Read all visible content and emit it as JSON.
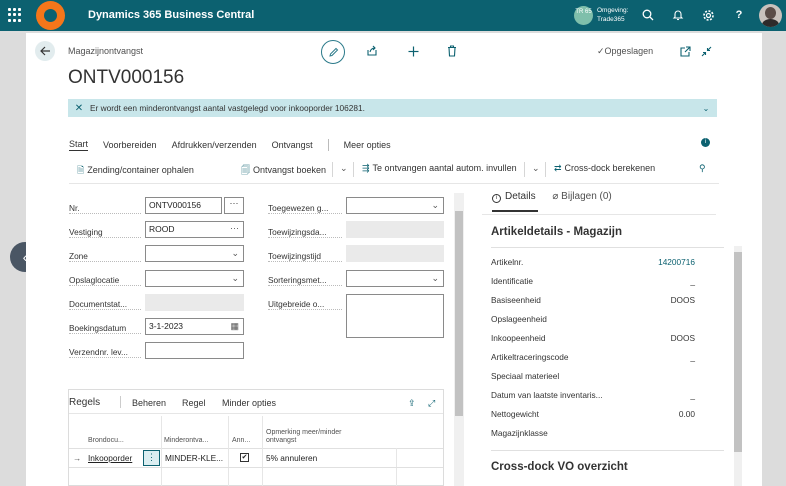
{
  "app": {
    "title": "Dynamics 365 Business Central"
  },
  "environment": {
    "badge": "TR 65",
    "label_line1": "Omgeving:",
    "label_line2": "Trade365"
  },
  "header": {
    "breadcrumb": "Magazijnontvangst",
    "page_title": "ONTV000156",
    "saved_state": "Opgeslagen"
  },
  "notification": {
    "text": "Er wordt een minderontvangst aantal vastgelegd voor inkooporder 106281."
  },
  "tabs": [
    "Start",
    "Voorbereiden",
    "Afdrukken/verzenden",
    "Ontvangst",
    "Meer opties"
  ],
  "actions": {
    "shipment": "Zending/container ophalen",
    "post_receipt": "Ontvangst boeken",
    "autofill": "Te ontvangen aantal autom. invullen",
    "crossdock": "Cross-dock berekenen"
  },
  "form": {
    "nr_label": "Nr.",
    "nr_value": "ONTV000156",
    "vestiging_label": "Vestiging",
    "vestiging_value": "ROOD",
    "zone_label": "Zone",
    "opslaglocatie_label": "Opslaglocatie",
    "documentstat_label": "Documentstat...",
    "boekingsdatum_label": "Boekingsdatum",
    "boekingsdatum_value": "3-1-2023",
    "verzendnr_label": "Verzendnr. lev...",
    "toegewezen_label": "Toegewezen g...",
    "toewijzingsda_label": "Toewijzingsda...",
    "toewijzingstijd_label": "Toewijzingstijd",
    "sorteringsmet_label": "Sorteringsmet...",
    "uitgebreide_label": "Uitgebreide o..."
  },
  "lines": {
    "title": "Regels",
    "menu": [
      "Beheren",
      "Regel",
      "Minder opties"
    ],
    "columns": [
      "Brondocu...",
      "Minderontva...",
      "Ann...",
      "Opmerking meer/minder ontvangst"
    ],
    "rows": [
      {
        "brondocument": "Inkooporder",
        "minderontvangst": "MINDER-KLE...",
        "annuleren": "✔",
        "opmerking": "5% annuleren"
      }
    ]
  },
  "factbox": {
    "tab_details": "Details",
    "tab_attachments": "Bijlagen (0)",
    "section_title": "Artikeldetails - Magazijn",
    "fields": [
      {
        "label": "Artikelnr.",
        "value": "14200716"
      },
      {
        "label": "Identificatie",
        "value": "_"
      },
      {
        "label": "Basiseenheid",
        "value": "DOOS"
      },
      {
        "label": "Opslageenheid",
        "value": ""
      },
      {
        "label": "Inkoopeenheid",
        "value": "DOOS"
      },
      {
        "label": "Artikeltraceringscode",
        "value": "_"
      },
      {
        "label": "Speciaal materieel",
        "value": ""
      },
      {
        "label": "Datum van laatste inventaris...",
        "value": "_"
      },
      {
        "label": "Nettogewicht",
        "value": "0.00"
      },
      {
        "label": "Magazijnklasse",
        "value": ""
      }
    ],
    "section2_title": "Cross-dock VO overzicht"
  },
  "colors": {
    "topbar": "#0c6170",
    "accent": "#0c6170",
    "notification_bg": "#c8e6ea",
    "logo": "#f5761a"
  }
}
